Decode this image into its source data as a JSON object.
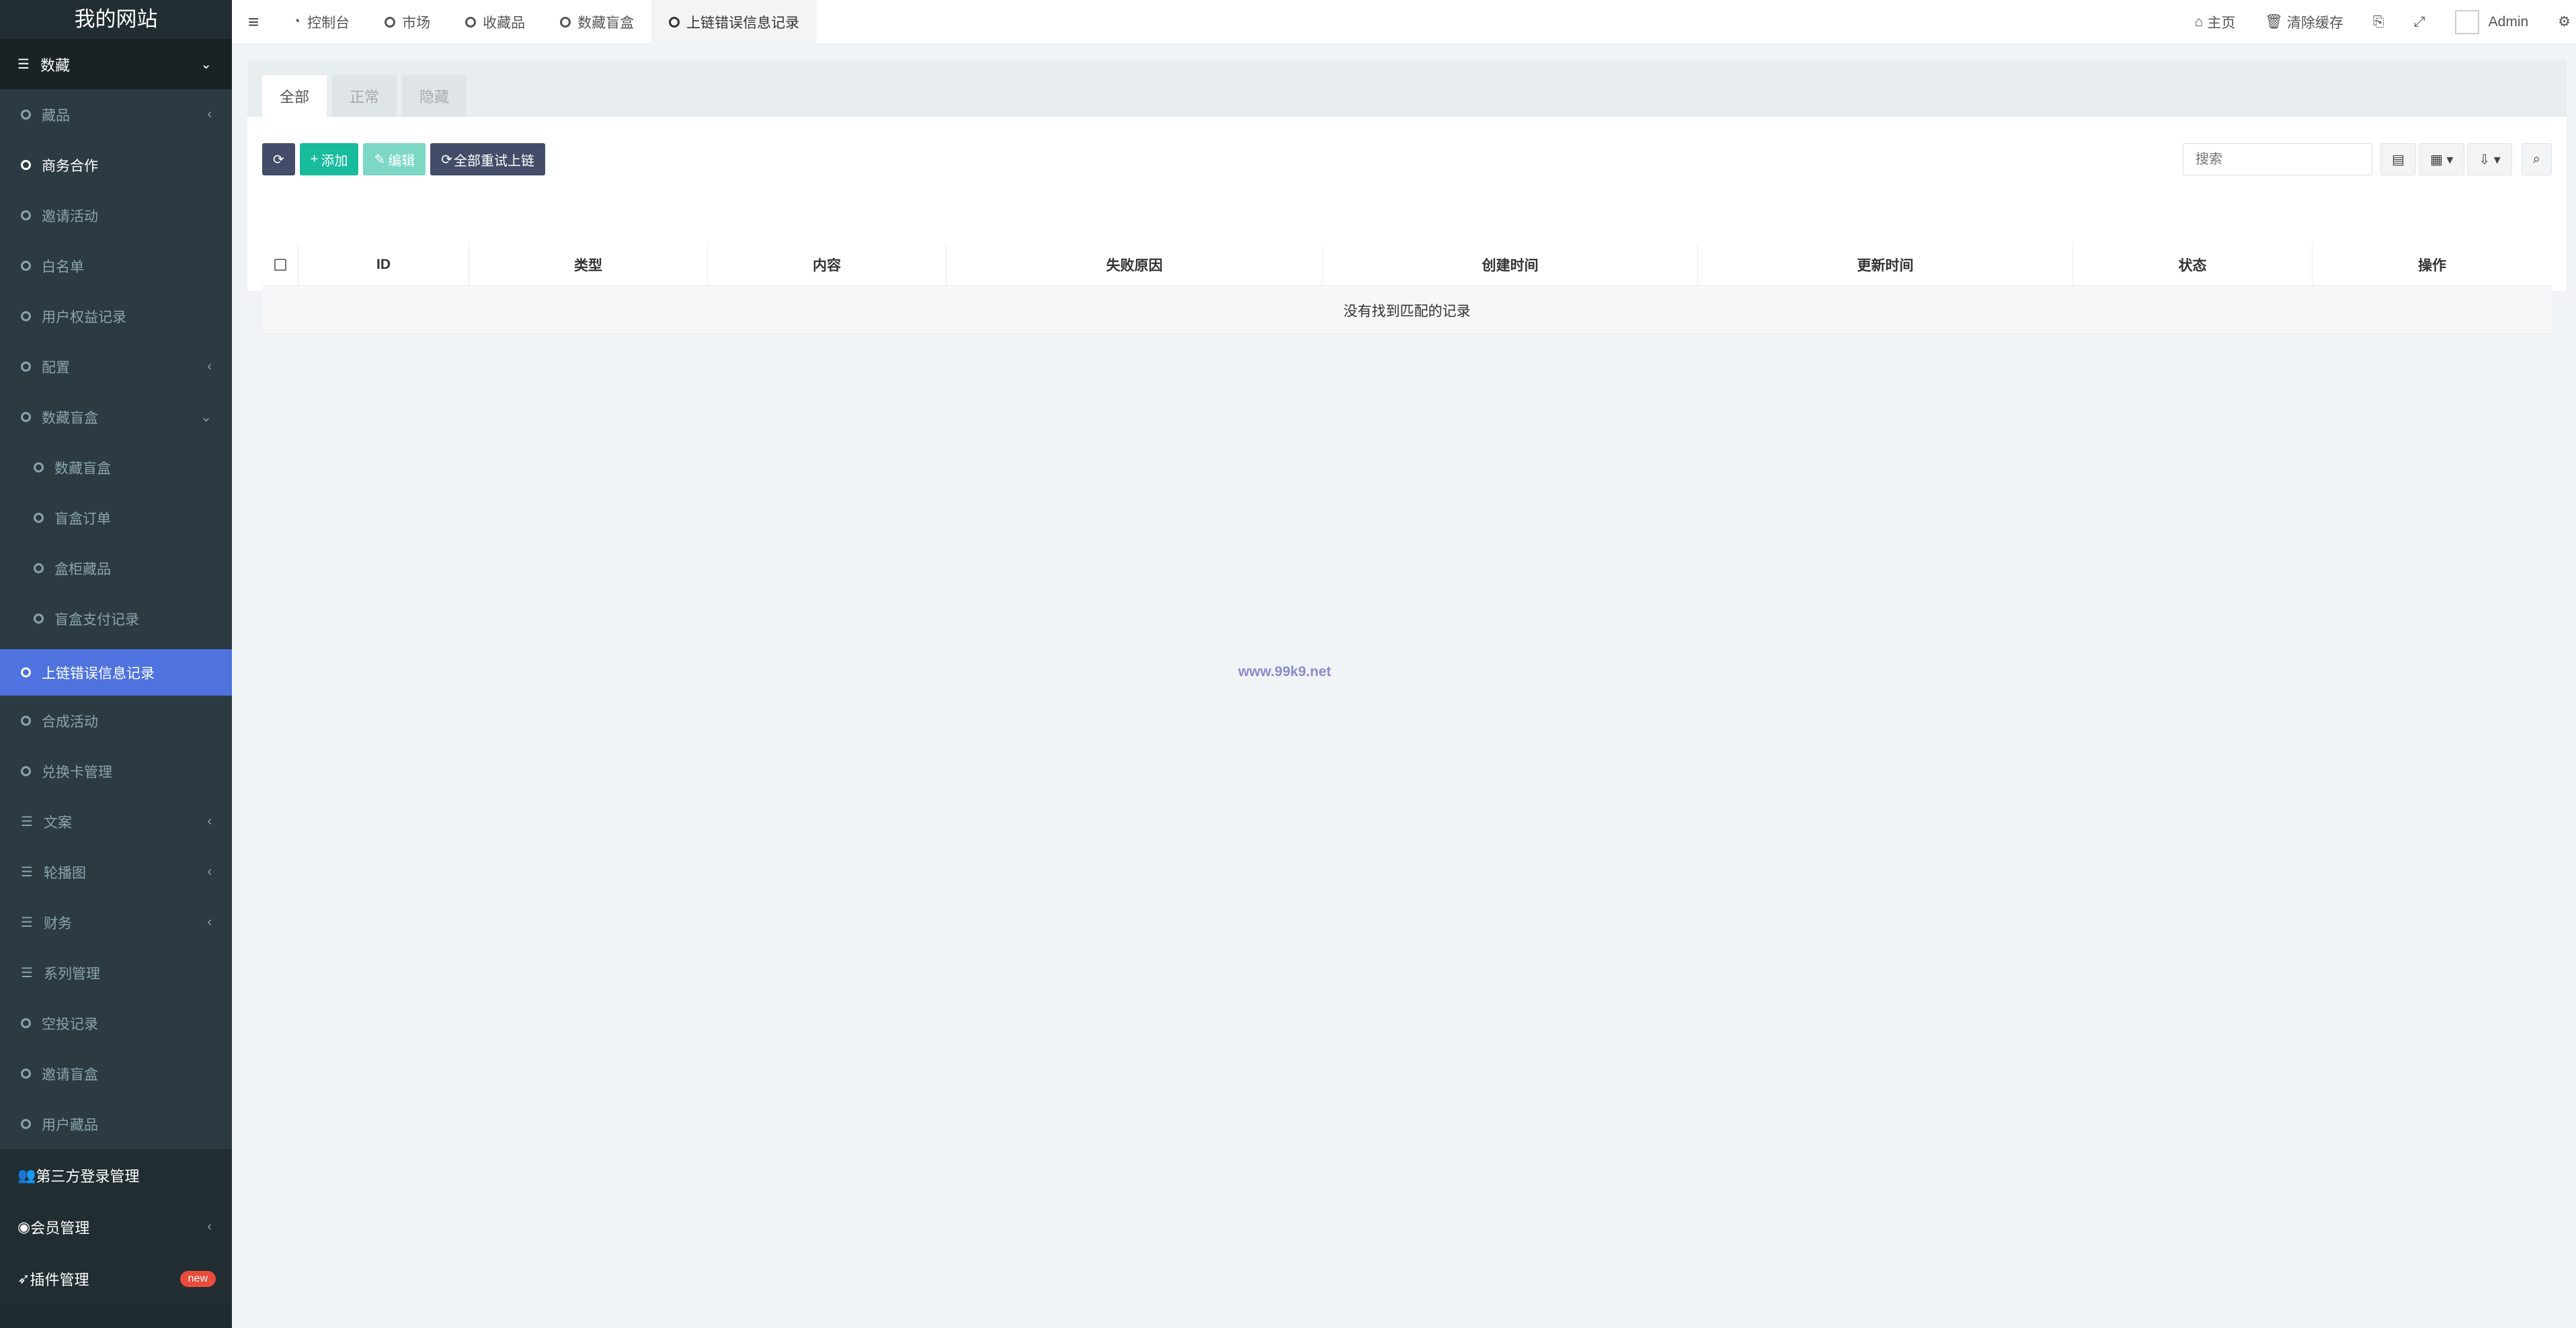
{
  "brand": "我的网站",
  "sidebar": {
    "group_collection": "数藏",
    "items": [
      {
        "label": "藏品",
        "arrow": "‹"
      },
      {
        "label": "商务合作",
        "arrow": ""
      },
      {
        "label": "邀请活动",
        "arrow": ""
      },
      {
        "label": "白名单",
        "arrow": ""
      },
      {
        "label": "用户权益记录",
        "arrow": ""
      },
      {
        "label": "配置",
        "arrow": "‹"
      },
      {
        "label": "数藏盲盒",
        "arrow": "⌄"
      }
    ],
    "sub_items": [
      {
        "label": "数藏盲盒"
      },
      {
        "label": "盲盒订单"
      },
      {
        "label": "盒柜藏品"
      },
      {
        "label": "盲盒支付记录"
      }
    ],
    "active_item": "上链错误信息记录",
    "items_after": [
      {
        "label": "合成活动",
        "type": "circle",
        "arrow": ""
      },
      {
        "label": "兑换卡管理",
        "type": "circle",
        "arrow": ""
      },
      {
        "label": "文案",
        "type": "list",
        "arrow": "‹"
      },
      {
        "label": "轮播图",
        "type": "list",
        "arrow": "‹"
      },
      {
        "label": "财务",
        "type": "list",
        "arrow": "‹"
      },
      {
        "label": "系列管理",
        "type": "list",
        "arrow": ""
      },
      {
        "label": "空投记录",
        "type": "circle",
        "arrow": ""
      },
      {
        "label": "邀请盲盒",
        "type": "circle",
        "arrow": ""
      },
      {
        "label": "用户藏品",
        "type": "circle",
        "arrow": ""
      }
    ],
    "bottom": [
      {
        "label": "第三方登录管理",
        "icon": "users-icon"
      },
      {
        "label": "会员管理",
        "icon": "user-icon",
        "arrow": "‹"
      },
      {
        "label": "插件管理",
        "icon": "rocket-icon",
        "badge": "new"
      }
    ]
  },
  "topnav": {
    "tabs": [
      {
        "label": "控制台",
        "icon": "dashboard-icon"
      },
      {
        "label": "市场",
        "icon": "circle-icon"
      },
      {
        "label": "收藏品",
        "icon": "circle-icon"
      },
      {
        "label": "数藏盲盒",
        "icon": "circle-icon"
      },
      {
        "label": "上链错误信息记录",
        "icon": "circle-icon"
      }
    ],
    "home": "主页",
    "clear_cache": "清除缓存",
    "user": "Admin"
  },
  "panel": {
    "tabs": [
      "全部",
      "正常",
      "隐藏"
    ],
    "toolbar": {
      "add": "添加",
      "edit": "编辑",
      "retry_all": "全部重试上链",
      "search_placeholder": "搜索"
    },
    "columns": [
      "ID",
      "类型",
      "内容",
      "失败原因",
      "创建时间",
      "更新时间",
      "状态",
      "操作"
    ],
    "empty_message": "没有找到匹配的记录"
  },
  "watermark": "www.99k9.net",
  "colors": {
    "sidebar_bg": "#1f2d32",
    "active_bg": "#4e73df",
    "primary_dark": "#444c69",
    "success": "#18bc9c",
    "badge": "#e74c3c"
  }
}
